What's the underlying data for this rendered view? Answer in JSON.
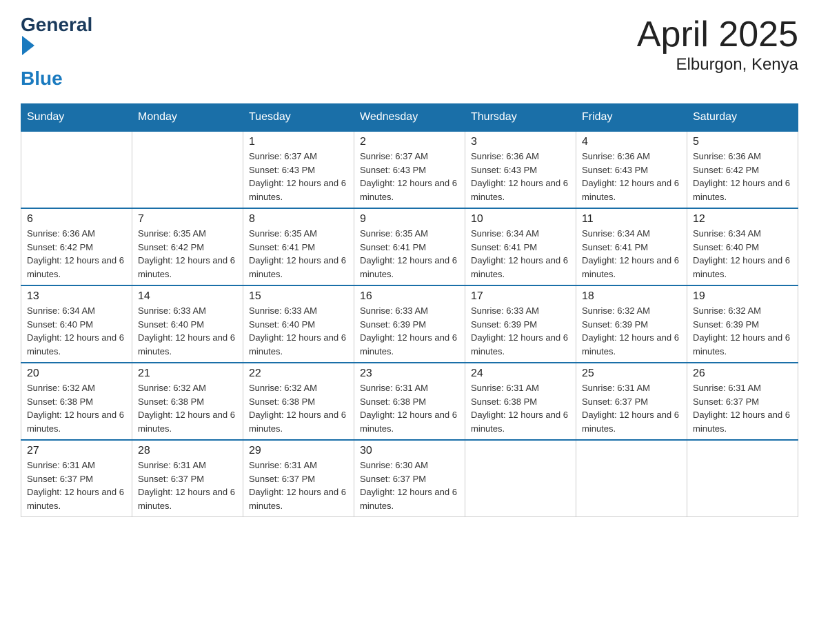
{
  "logo": {
    "text_general": "General",
    "text_blue": "Blue"
  },
  "title": {
    "month_year": "April 2025",
    "location": "Elburgon, Kenya"
  },
  "weekdays": [
    "Sunday",
    "Monday",
    "Tuesday",
    "Wednesday",
    "Thursday",
    "Friday",
    "Saturday"
  ],
  "weeks": [
    [
      {
        "day": "",
        "sunrise": "",
        "sunset": "",
        "daylight": ""
      },
      {
        "day": "",
        "sunrise": "",
        "sunset": "",
        "daylight": ""
      },
      {
        "day": "1",
        "sunrise": "Sunrise: 6:37 AM",
        "sunset": "Sunset: 6:43 PM",
        "daylight": "Daylight: 12 hours and 6 minutes."
      },
      {
        "day": "2",
        "sunrise": "Sunrise: 6:37 AM",
        "sunset": "Sunset: 6:43 PM",
        "daylight": "Daylight: 12 hours and 6 minutes."
      },
      {
        "day": "3",
        "sunrise": "Sunrise: 6:36 AM",
        "sunset": "Sunset: 6:43 PM",
        "daylight": "Daylight: 12 hours and 6 minutes."
      },
      {
        "day": "4",
        "sunrise": "Sunrise: 6:36 AM",
        "sunset": "Sunset: 6:43 PM",
        "daylight": "Daylight: 12 hours and 6 minutes."
      },
      {
        "day": "5",
        "sunrise": "Sunrise: 6:36 AM",
        "sunset": "Sunset: 6:42 PM",
        "daylight": "Daylight: 12 hours and 6 minutes."
      }
    ],
    [
      {
        "day": "6",
        "sunrise": "Sunrise: 6:36 AM",
        "sunset": "Sunset: 6:42 PM",
        "daylight": "Daylight: 12 hours and 6 minutes."
      },
      {
        "day": "7",
        "sunrise": "Sunrise: 6:35 AM",
        "sunset": "Sunset: 6:42 PM",
        "daylight": "Daylight: 12 hours and 6 minutes."
      },
      {
        "day": "8",
        "sunrise": "Sunrise: 6:35 AM",
        "sunset": "Sunset: 6:41 PM",
        "daylight": "Daylight: 12 hours and 6 minutes."
      },
      {
        "day": "9",
        "sunrise": "Sunrise: 6:35 AM",
        "sunset": "Sunset: 6:41 PM",
        "daylight": "Daylight: 12 hours and 6 minutes."
      },
      {
        "day": "10",
        "sunrise": "Sunrise: 6:34 AM",
        "sunset": "Sunset: 6:41 PM",
        "daylight": "Daylight: 12 hours and 6 minutes."
      },
      {
        "day": "11",
        "sunrise": "Sunrise: 6:34 AM",
        "sunset": "Sunset: 6:41 PM",
        "daylight": "Daylight: 12 hours and 6 minutes."
      },
      {
        "day": "12",
        "sunrise": "Sunrise: 6:34 AM",
        "sunset": "Sunset: 6:40 PM",
        "daylight": "Daylight: 12 hours and 6 minutes."
      }
    ],
    [
      {
        "day": "13",
        "sunrise": "Sunrise: 6:34 AM",
        "sunset": "Sunset: 6:40 PM",
        "daylight": "Daylight: 12 hours and 6 minutes."
      },
      {
        "day": "14",
        "sunrise": "Sunrise: 6:33 AM",
        "sunset": "Sunset: 6:40 PM",
        "daylight": "Daylight: 12 hours and 6 minutes."
      },
      {
        "day": "15",
        "sunrise": "Sunrise: 6:33 AM",
        "sunset": "Sunset: 6:40 PM",
        "daylight": "Daylight: 12 hours and 6 minutes."
      },
      {
        "day": "16",
        "sunrise": "Sunrise: 6:33 AM",
        "sunset": "Sunset: 6:39 PM",
        "daylight": "Daylight: 12 hours and 6 minutes."
      },
      {
        "day": "17",
        "sunrise": "Sunrise: 6:33 AM",
        "sunset": "Sunset: 6:39 PM",
        "daylight": "Daylight: 12 hours and 6 minutes."
      },
      {
        "day": "18",
        "sunrise": "Sunrise: 6:32 AM",
        "sunset": "Sunset: 6:39 PM",
        "daylight": "Daylight: 12 hours and 6 minutes."
      },
      {
        "day": "19",
        "sunrise": "Sunrise: 6:32 AM",
        "sunset": "Sunset: 6:39 PM",
        "daylight": "Daylight: 12 hours and 6 minutes."
      }
    ],
    [
      {
        "day": "20",
        "sunrise": "Sunrise: 6:32 AM",
        "sunset": "Sunset: 6:38 PM",
        "daylight": "Daylight: 12 hours and 6 minutes."
      },
      {
        "day": "21",
        "sunrise": "Sunrise: 6:32 AM",
        "sunset": "Sunset: 6:38 PM",
        "daylight": "Daylight: 12 hours and 6 minutes."
      },
      {
        "day": "22",
        "sunrise": "Sunrise: 6:32 AM",
        "sunset": "Sunset: 6:38 PM",
        "daylight": "Daylight: 12 hours and 6 minutes."
      },
      {
        "day": "23",
        "sunrise": "Sunrise: 6:31 AM",
        "sunset": "Sunset: 6:38 PM",
        "daylight": "Daylight: 12 hours and 6 minutes."
      },
      {
        "day": "24",
        "sunrise": "Sunrise: 6:31 AM",
        "sunset": "Sunset: 6:38 PM",
        "daylight": "Daylight: 12 hours and 6 minutes."
      },
      {
        "day": "25",
        "sunrise": "Sunrise: 6:31 AM",
        "sunset": "Sunset: 6:37 PM",
        "daylight": "Daylight: 12 hours and 6 minutes."
      },
      {
        "day": "26",
        "sunrise": "Sunrise: 6:31 AM",
        "sunset": "Sunset: 6:37 PM",
        "daylight": "Daylight: 12 hours and 6 minutes."
      }
    ],
    [
      {
        "day": "27",
        "sunrise": "Sunrise: 6:31 AM",
        "sunset": "Sunset: 6:37 PM",
        "daylight": "Daylight: 12 hours and 6 minutes."
      },
      {
        "day": "28",
        "sunrise": "Sunrise: 6:31 AM",
        "sunset": "Sunset: 6:37 PM",
        "daylight": "Daylight: 12 hours and 6 minutes."
      },
      {
        "day": "29",
        "sunrise": "Sunrise: 6:31 AM",
        "sunset": "Sunset: 6:37 PM",
        "daylight": "Daylight: 12 hours and 6 minutes."
      },
      {
        "day": "30",
        "sunrise": "Sunrise: 6:30 AM",
        "sunset": "Sunset: 6:37 PM",
        "daylight": "Daylight: 12 hours and 6 minutes."
      },
      {
        "day": "",
        "sunrise": "",
        "sunset": "",
        "daylight": ""
      },
      {
        "day": "",
        "sunrise": "",
        "sunset": "",
        "daylight": ""
      },
      {
        "day": "",
        "sunrise": "",
        "sunset": "",
        "daylight": ""
      }
    ]
  ]
}
